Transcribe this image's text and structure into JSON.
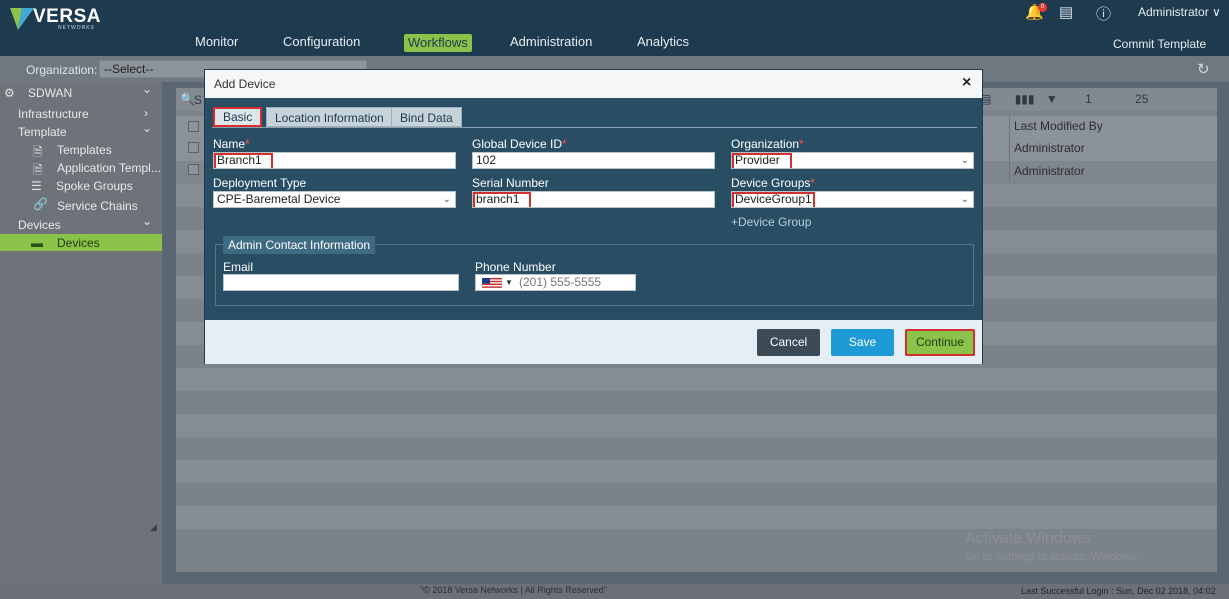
{
  "header": {
    "brand": "VERSA",
    "brand_sub": "NETWORKS",
    "nav": [
      "Monitor",
      "Configuration",
      "Workflows",
      "Administration",
      "Analytics"
    ],
    "active_nav": "Workflows",
    "notification_count": "0",
    "user": "Administrator ∨",
    "commit_label": "Commit Template",
    "accent": "#8bc34a"
  },
  "orgbar": {
    "label": "Organization:",
    "select_value": "--Select--"
  },
  "sidebar": {
    "items": [
      {
        "label": "SDWAN"
      },
      {
        "label": "Infrastructure"
      },
      {
        "label": "Template"
      },
      {
        "label": "Templates"
      },
      {
        "label": "Application Templ..."
      },
      {
        "label": "Spoke Groups"
      },
      {
        "label": "Service Chains"
      },
      {
        "label": "Devices"
      },
      {
        "label": "Devices"
      }
    ]
  },
  "table": {
    "search_placeholder": "S",
    "page_value": "1",
    "page_size": "25",
    "last_modified_header": "Last Modified By",
    "rows": [
      {
        "last_modified_by": "Administrator"
      },
      {
        "last_modified_by": "Administrator"
      }
    ]
  },
  "modal": {
    "title": "Add Device",
    "close": "×",
    "tabs": [
      "Basic",
      "Location Information",
      "Bind Data"
    ],
    "fields": {
      "name": {
        "label": "Name",
        "value": "Branch1"
      },
      "global_device_id": {
        "label": "Global Device ID",
        "value": "102"
      },
      "organization": {
        "label": "Organization",
        "value": "Provider"
      },
      "deployment_type": {
        "label": "Deployment Type",
        "value": "CPE-Baremetal Device"
      },
      "serial_number": {
        "label": "Serial Number",
        "value": "branch1"
      },
      "device_groups": {
        "label": "Device Groups",
        "value": "DeviceGroup1"
      }
    },
    "add_device_group": "+Device Group",
    "admin_contact": {
      "legend": "Admin Contact Information",
      "email_label": "Email",
      "email_value": "",
      "phone_label": "Phone Number",
      "phone_placeholder": "(201) 555-5555"
    },
    "buttons": {
      "cancel": "Cancel",
      "save": "Save",
      "continue": "Continue"
    }
  },
  "footer": {
    "copyright": "\"© 2018 Versa Networks | All Rights Reserved\"",
    "last_login": "Last Successful Login : Sun, Dec 02 2018, 04:02"
  },
  "watermark": {
    "line1": "Activate Windows",
    "line2": "Go to Settings to activate Windows."
  }
}
